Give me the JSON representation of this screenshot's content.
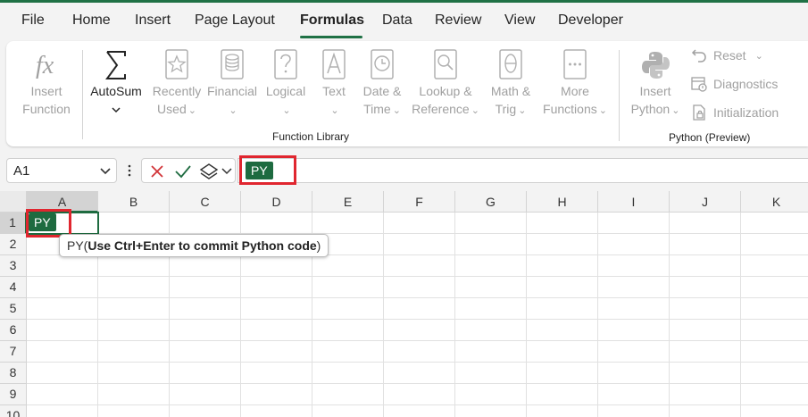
{
  "menu": {
    "tabs": [
      "File",
      "Home",
      "Insert",
      "Page Layout",
      "Formulas",
      "Data",
      "Review",
      "View",
      "Developer"
    ],
    "active_tab": "Formulas"
  },
  "ribbon": {
    "insert_function": {
      "line1": "Insert",
      "line2": "Function",
      "icon": "fx-icon"
    },
    "autosum": {
      "line1": "AutoSum",
      "icon": "sigma-icon"
    },
    "recently_used": {
      "line1": "Recently",
      "line2": "Used",
      "icon": "star-book-icon"
    },
    "financial": {
      "line1": "Financial",
      "icon": "database-book-icon"
    },
    "logical": {
      "line1": "Logical",
      "icon": "question-book-icon"
    },
    "text": {
      "line1": "Text",
      "icon": "letter-a-book-icon"
    },
    "date_time": {
      "line1": "Date &",
      "line2": "Time",
      "icon": "clock-book-icon"
    },
    "lookup_reference": {
      "line1": "Lookup &",
      "line2": "Reference",
      "icon": "magnifier-book-icon"
    },
    "math_trig": {
      "line1": "Math &",
      "line2": "Trig",
      "icon": "theta-book-icon"
    },
    "more_functions": {
      "line1": "More",
      "line2": "Functions",
      "icon": "ellipsis-book-icon"
    },
    "function_library_label": "Function Library",
    "insert_python": {
      "line1": "Insert",
      "line2": "Python",
      "icon": "python-icon"
    },
    "reset": "Reset",
    "diagnostics": "Diagnostics",
    "initialization": "Initialization",
    "python_group_label": "Python (Preview)"
  },
  "formula_bar": {
    "name_box": "A1",
    "py_badge": "PY"
  },
  "grid": {
    "columns": [
      "A",
      "B",
      "C",
      "D",
      "E",
      "F",
      "G",
      "H",
      "I",
      "J",
      "K"
    ],
    "rows": [
      "1",
      "2",
      "3",
      "4",
      "5",
      "6",
      "7",
      "8",
      "9",
      "10"
    ],
    "active_cell_badge": "PY"
  },
  "tooltip": {
    "prefix": "PY(",
    "bold": "Use Ctrl+Enter to commit Python code",
    "suffix": ")"
  },
  "colors": {
    "accent": "#1e6b40",
    "highlight": "#e0262f"
  }
}
